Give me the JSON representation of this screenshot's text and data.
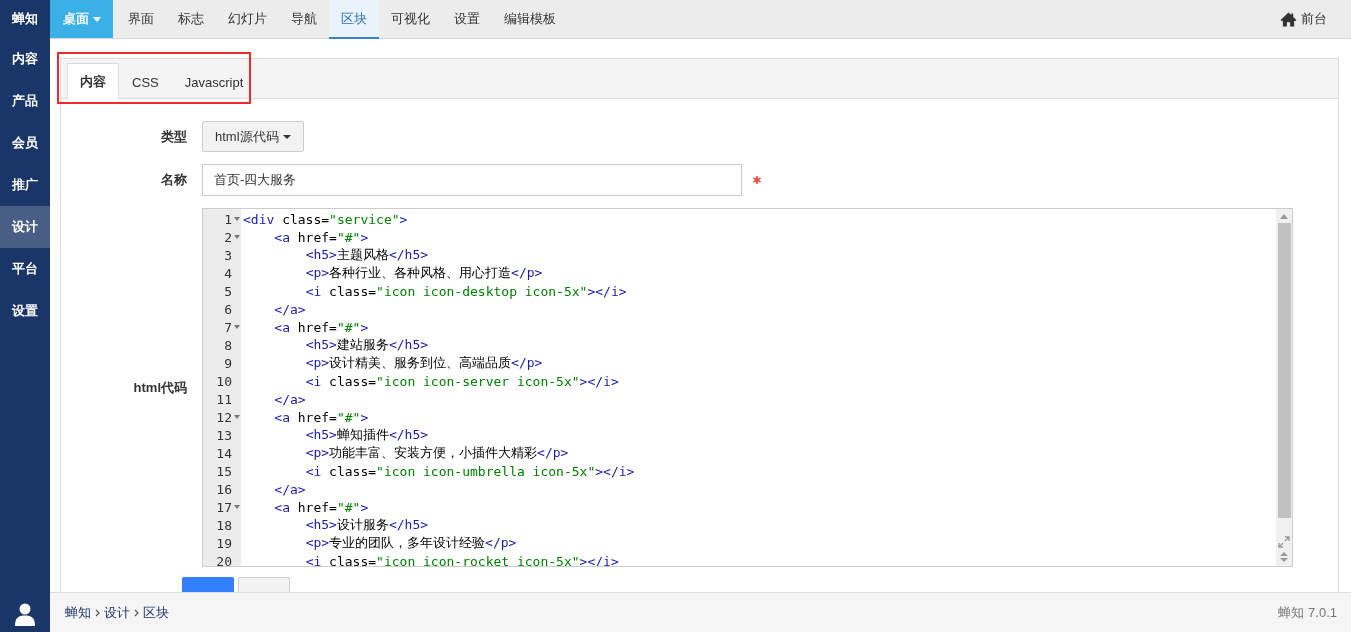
{
  "sidebar": {
    "brand": "蝉知",
    "items": [
      {
        "label": "内容",
        "selected": false
      },
      {
        "label": "产品",
        "selected": false
      },
      {
        "label": "会员",
        "selected": false
      },
      {
        "label": "推广",
        "selected": false
      },
      {
        "label": "设计",
        "selected": true
      },
      {
        "label": "平台",
        "selected": false
      },
      {
        "label": "设置",
        "selected": false
      }
    ]
  },
  "topnav": {
    "menu_button": "桌面",
    "tabs": [
      {
        "label": "界面",
        "selected": false
      },
      {
        "label": "标志",
        "selected": false
      },
      {
        "label": "幻灯片",
        "selected": false
      },
      {
        "label": "导航",
        "selected": false
      },
      {
        "label": "区块",
        "selected": true
      },
      {
        "label": "可视化",
        "selected": false
      },
      {
        "label": "设置",
        "selected": false
      },
      {
        "label": "编辑模板",
        "selected": false
      }
    ],
    "frontend_link": "前台"
  },
  "panel": {
    "tabs": [
      {
        "label": "内容",
        "selected": true
      },
      {
        "label": "CSS",
        "selected": false
      },
      {
        "label": "Javascript",
        "selected": false
      }
    ],
    "form": {
      "type_label": "类型",
      "type_value": "html源代码",
      "name_label": "名称",
      "name_value": "首页-四大服务",
      "name_required": true,
      "code_label": "html代码",
      "code_lines": [
        {
          "number": "1",
          "fold": true,
          "text": "<div class=\"service\">"
        },
        {
          "number": "2",
          "fold": true,
          "text": "    <a href=\"#\">"
        },
        {
          "number": "3",
          "fold": false,
          "text": "        <h5>主题风格</h5>"
        },
        {
          "number": "4",
          "fold": false,
          "text": "        <p>各种行业、各种风格、用心打造</p>"
        },
        {
          "number": "5",
          "fold": false,
          "text": "        <i class=\"icon icon-desktop icon-5x\"></i>"
        },
        {
          "number": "6",
          "fold": false,
          "text": "    </a>"
        },
        {
          "number": "7",
          "fold": true,
          "text": "    <a href=\"#\">"
        },
        {
          "number": "8",
          "fold": false,
          "text": "        <h5>建站服务</h5>"
        },
        {
          "number": "9",
          "fold": false,
          "text": "        <p>设计精美、服务到位、高端品质</p>"
        },
        {
          "number": "10",
          "fold": false,
          "text": "        <i class=\"icon icon-server icon-5x\"></i>"
        },
        {
          "number": "11",
          "fold": false,
          "text": "    </a>"
        },
        {
          "number": "12",
          "fold": true,
          "text": "    <a href=\"#\">"
        },
        {
          "number": "13",
          "fold": false,
          "text": "        <h5>蝉知插件</h5>"
        },
        {
          "number": "14",
          "fold": false,
          "text": "        <p>功能丰富、安装方便，小插件大精彩</p>"
        },
        {
          "number": "15",
          "fold": false,
          "text": "        <i class=\"icon icon-umbrella icon-5x\"></i>"
        },
        {
          "number": "16",
          "fold": false,
          "text": "    </a>"
        },
        {
          "number": "17",
          "fold": true,
          "text": "    <a href=\"#\">"
        },
        {
          "number": "18",
          "fold": false,
          "text": "        <h5>设计服务</h5>"
        },
        {
          "number": "19",
          "fold": false,
          "text": "        <p>专业的团队，多年设计经验</p>"
        },
        {
          "number": "20",
          "fold": false,
          "text": "        <i class=\"icon icon-rocket icon-5x\"></i>"
        }
      ],
      "buttons": [
        {
          "kind": "primary"
        },
        {
          "kind": "default"
        }
      ]
    }
  },
  "footer": {
    "breadcrumb": [
      "蝉知",
      "设计",
      "区块"
    ],
    "version": "蝉知 7.0.1"
  }
}
